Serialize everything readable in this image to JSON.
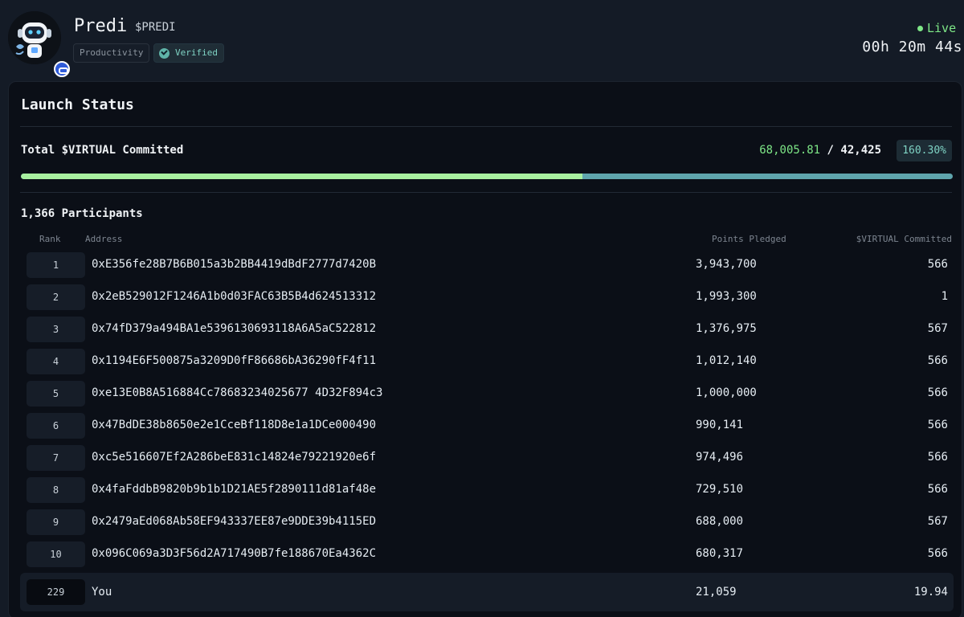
{
  "header": {
    "title": "Predi",
    "ticker": "$PREDI",
    "tags": {
      "category": "Productivity",
      "verified": "Verified"
    },
    "status": "Live",
    "countdown": "00h 20m 44s"
  },
  "panel": {
    "title": "Launch Status",
    "committed": {
      "label": "Total $VIRTUAL Committed",
      "current": "68,005.81",
      "separator": "/",
      "target": "42,425",
      "percent": "160.30%",
      "progress_fraction": 0.603
    },
    "participants_label": "1,366 Participants",
    "table": {
      "columns": {
        "rank": "Rank",
        "address": "Address",
        "points": "Points Pledged",
        "virtual": "$VIRTUAL Committed"
      },
      "rows": [
        {
          "rank": "1",
          "address": "0xE356fe28B7B6B015a3b2BB4419dBdF2777d7420B",
          "points": "3,943,700",
          "virtual": "566"
        },
        {
          "rank": "2",
          "address": "0x2eB529012F1246A1b0d03FAC63B5B4d624513312",
          "points": "1,993,300",
          "virtual": "1"
        },
        {
          "rank": "3",
          "address": "0x74fD379a494BA1e5396130693118A6A5aC522812",
          "points": "1,376,975",
          "virtual": "567"
        },
        {
          "rank": "4",
          "address": "0x1194E6F500875a3209D0fF86686bA36290fF4f11",
          "points": "1,012,140",
          "virtual": "566"
        },
        {
          "rank": "5",
          "address": "0xe13E0B8A516884Cc78683234025677 4D32F894c3",
          "points": "1,000,000",
          "virtual": "566"
        },
        {
          "rank": "6",
          "address": "0x47BdDE38b8650e2e1CceBf118D8e1a1DCe000490",
          "points": "990,141",
          "virtual": "566"
        },
        {
          "rank": "7",
          "address": "0xc5e516607Ef2A286beE831c14824e79221920e6f",
          "points": "974,496",
          "virtual": "566"
        },
        {
          "rank": "8",
          "address": "0x4faFddbB9820b9b1b1D21AE5f2890111d81af48e",
          "points": "729,510",
          "virtual": "566"
        },
        {
          "rank": "9",
          "address": "0x2479aEd068Ab58EF943337EE87e9DDE39b4115ED",
          "points": "688,000",
          "virtual": "567"
        },
        {
          "rank": "10",
          "address": "0x096C069a3D3F56d2A717490B7fe188670Ea4362C",
          "points": "680,317",
          "virtual": "566"
        }
      ],
      "you": {
        "rank": "229",
        "address": "You",
        "points": "21,059",
        "virtual": "19.94"
      }
    }
  },
  "colors": {
    "accent_green": "#7ee787",
    "accent_teal": "#7fd3c4",
    "panel_bg": "#0b0f17",
    "page_bg": "#141b26"
  },
  "icons": [
    "robot-avatar-icon",
    "swap-badge-icon",
    "verified-check-icon",
    "live-dot-icon"
  ]
}
